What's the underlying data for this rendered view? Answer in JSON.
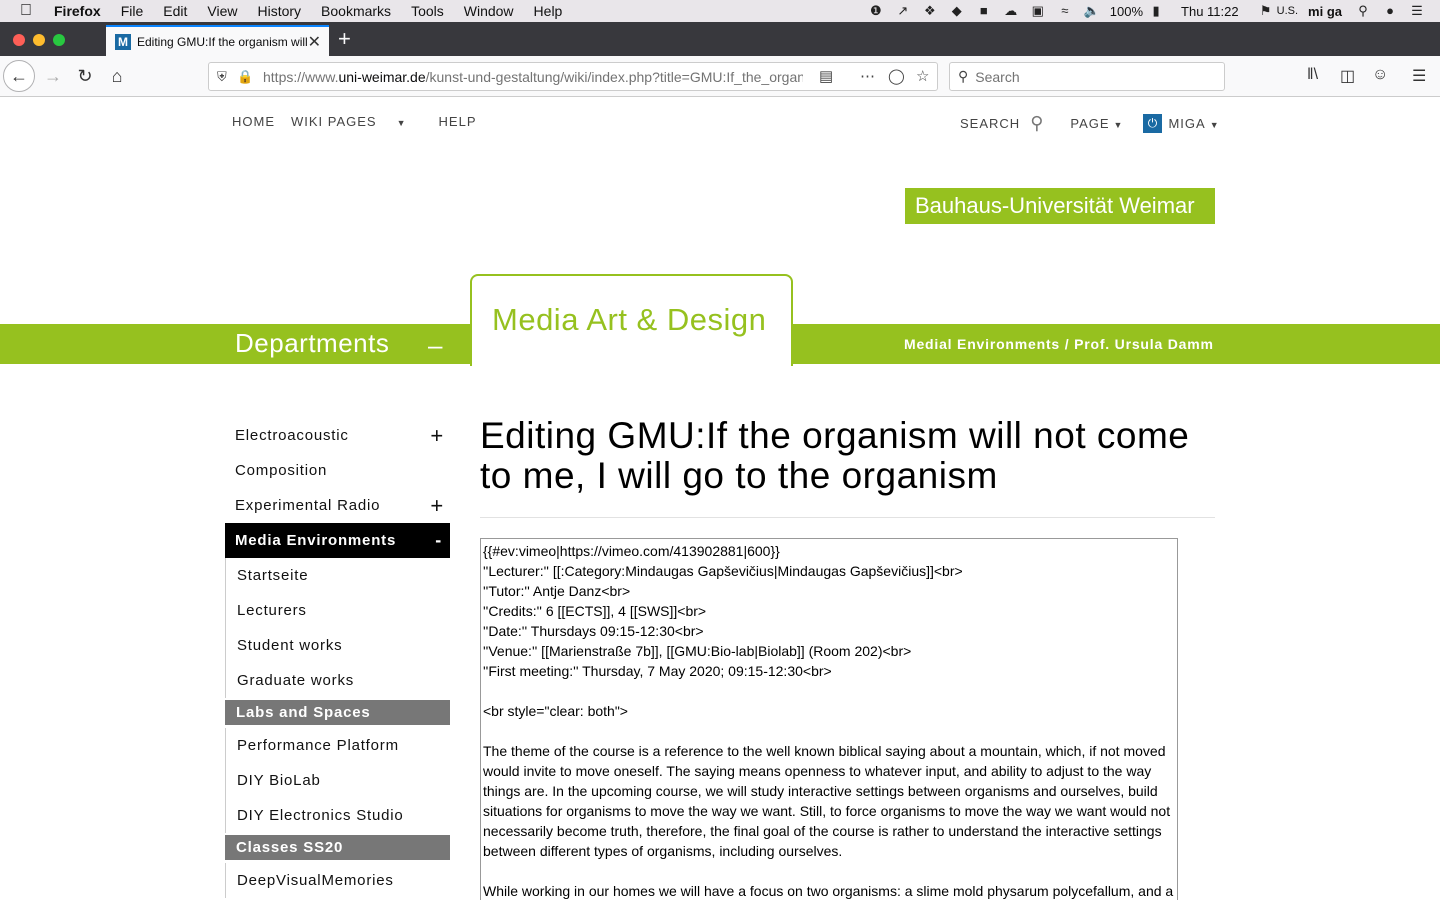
{
  "menubar": {
    "app": "Firefox",
    "items": [
      "File",
      "Edit",
      "View",
      "History",
      "Bookmarks",
      "Tools",
      "Window",
      "Help"
    ],
    "battery": "100%",
    "clock": "Thu 11:22",
    "input_source": "U.S.",
    "user": "mi ga"
  },
  "browser": {
    "tab_title": "Editing GMU:If the organism will not come to me, I will go to the organism",
    "url_prefix": "https://www.",
    "url_domain": "uni-weimar.de",
    "url_path": "/kunst-und-gestaltung/wiki/index.php?title=GMU:If_the_organism_will_not_come_to_me",
    "search_placeholder": "Search"
  },
  "site": {
    "nav": {
      "home": "HOME",
      "wiki_pages": "WIKI PAGES",
      "help": "HELP",
      "search": "SEARCH",
      "page": "PAGE",
      "user": "MIGA"
    },
    "logo_text": "Bauhaus-Universität Weimar",
    "departments": "Departments",
    "departments_toggle": "–",
    "section_title": "Media Art & Design",
    "chair": "Medial Environments / Prof. Ursula Damm",
    "accent_color": "#96c11f"
  },
  "sidebar": {
    "electroacoustic": "Electroacoustic",
    "composition": "Composition",
    "experimental_radio": "Experimental Radio",
    "media_environments": "Media Environments",
    "plus": "+",
    "minus": "-",
    "startseite": "Startseite",
    "lecturers": "Lecturers",
    "student_works": "Student works",
    "graduate_works": "Graduate works",
    "labs_heading": "Labs and Spaces",
    "performance_platform": "Performance Platform",
    "diy_biolab": "DIY BioLab",
    "diy_electronics": "DIY Electronics Studio",
    "classes_heading": "Classes SS20",
    "deepvisual": "DeepVisualMemories BA/BfA"
  },
  "main": {
    "heading": "Editing GMU:If the organism will not come to me, I will go to the organism",
    "editor_lines": [
      "{{#ev:vimeo|https://vimeo.com/413902881|600}}",
      "''Lecturer:'' [[:Category:Mindaugas Gapševičius|Mindaugas Gapševičius]]<br>",
      "''Tutor:'' Antje Danz<br>",
      "''Credits:'' 6 [[ECTS]], 4 [[SWS]]<br>",
      "''Date:'' Thursdays 09:15-12:30<br>",
      "''Venue:'' [[Marienstraße 7b]], [[GMU:Bio-lab|Biolab]] (Room 202)<br>",
      "''First meeting:'' Thursday, 7 May 2020; 09:15-12:30<br>",
      "",
      "<br style=\"clear: both\">",
      "",
      "The theme of the course is a reference to the well known biblical saying about a mountain, which, if not moved would invite to move oneself. The saying means openness to whatever input, and ability to adjust to the way things are. In the upcoming course, we will study interactive settings between organisms and ourselves, build situations for organisms to move the way we want. Still, to force organisms to move the way we want would not necessarily become truth, therefore, the final goal of the course is rather to understand the interactive settings between different types of organisms, including ourselves.",
      "",
      "While working in our homes we will have a focus on two organisms: a slime mold physarum polycefallum, and a"
    ]
  }
}
